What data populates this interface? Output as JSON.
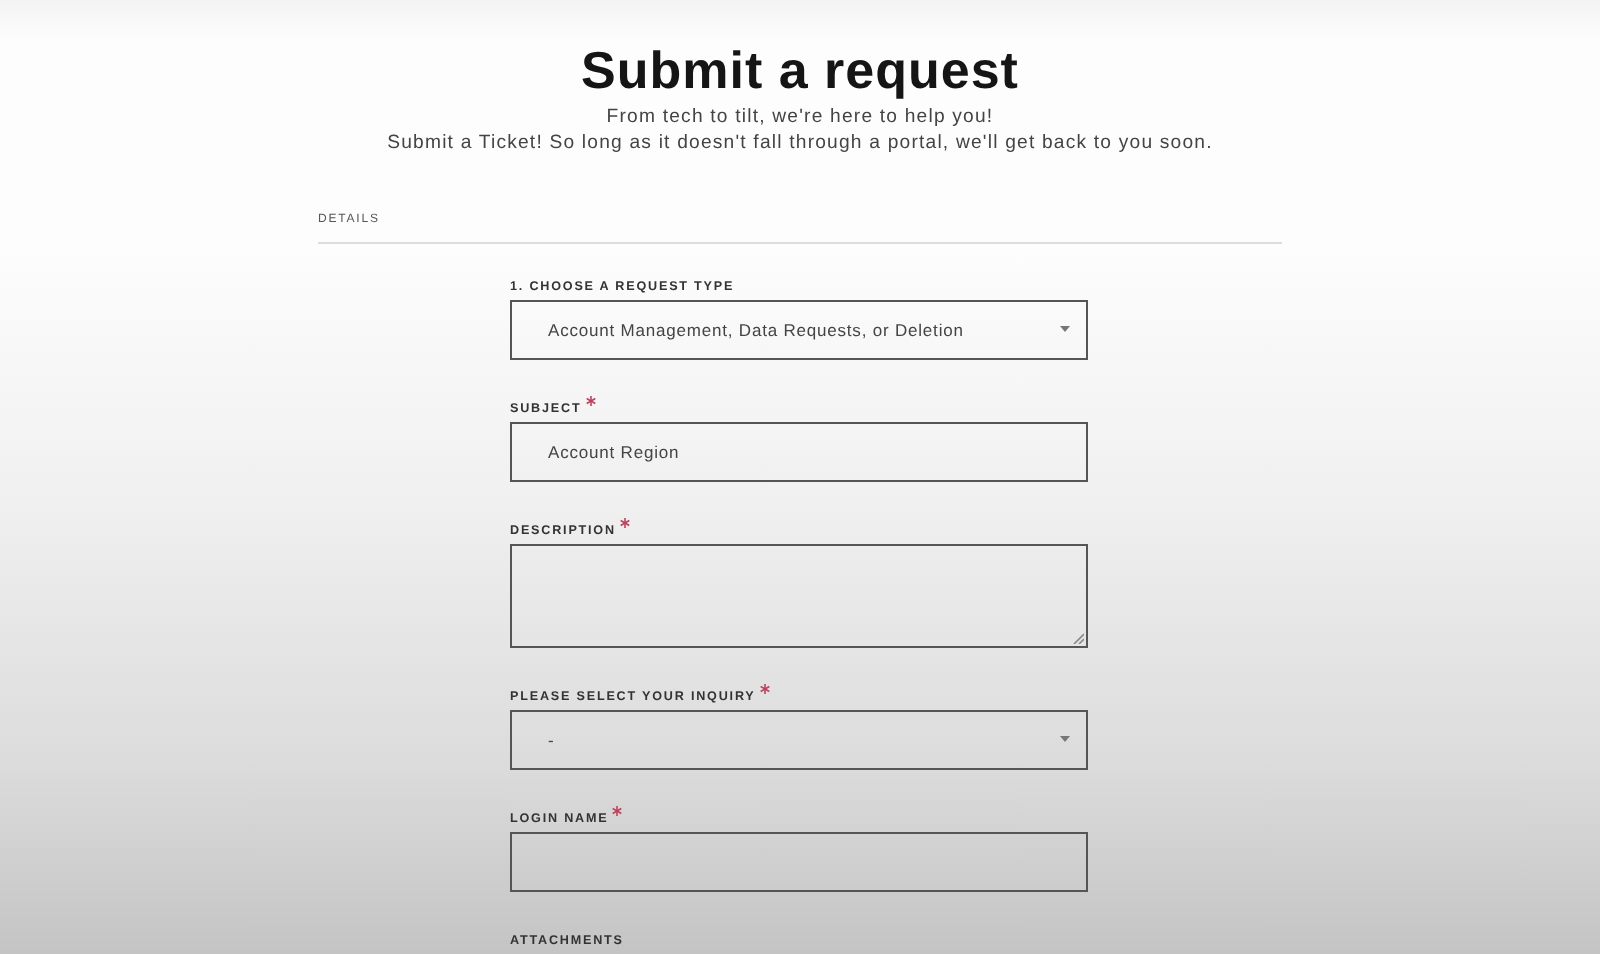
{
  "header": {
    "title": "Submit a request",
    "subtitle_lines": [
      "From tech to tilt, we're here to help you!",
      "Submit a Ticket! So long as it doesn't fall through a portal, we'll get back to you soon."
    ]
  },
  "section": {
    "label": "DETAILS"
  },
  "fields": [
    {
      "kind": "select",
      "label": "1. CHOOSE A REQUEST TYPE",
      "required": false,
      "value": "Account Management, Data Requests, or Deletion"
    },
    {
      "kind": "text",
      "label": "SUBJECT",
      "required": true,
      "value": "Account Region"
    },
    {
      "kind": "textarea",
      "label": "DESCRIPTION",
      "required": true
    },
    {
      "kind": "select",
      "label": "PLEASE SELECT YOUR INQUIRY",
      "required": true,
      "value": "-"
    },
    {
      "kind": "text",
      "label": "LOGIN NAME",
      "required": true
    },
    {
      "kind": "attachments",
      "label": "ATTACHMENTS",
      "required": false
    }
  ]
}
